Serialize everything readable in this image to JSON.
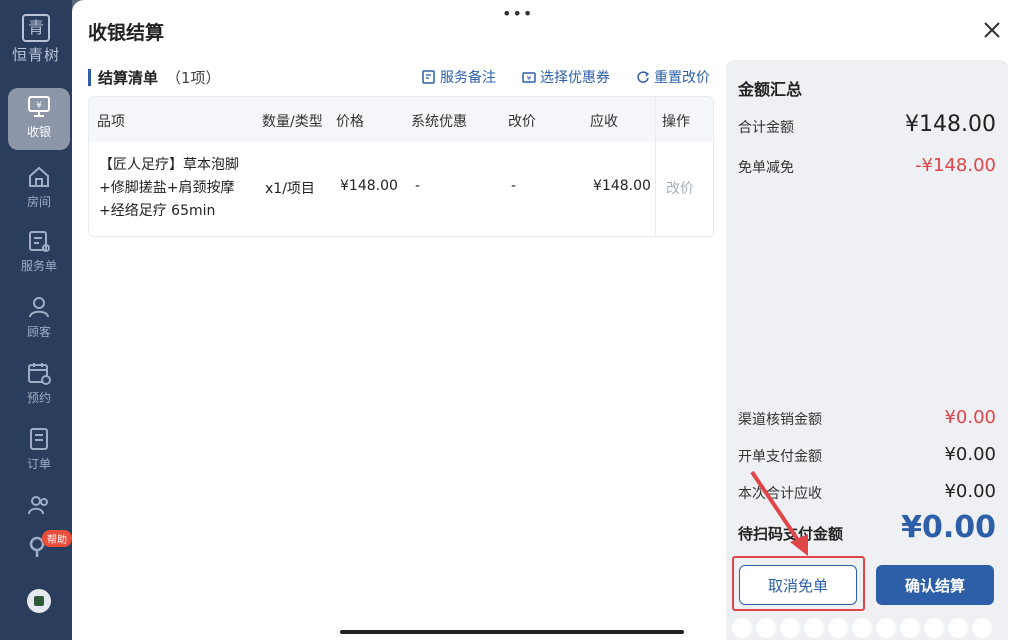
{
  "sidebar": {
    "logo_glyph": "青",
    "logo_name": "恒青树",
    "items": [
      {
        "label": "收银",
        "icon": "cashier-icon",
        "active": true
      },
      {
        "label": "房间",
        "icon": "home-icon"
      },
      {
        "label": "服务单",
        "icon": "service-order-icon"
      },
      {
        "label": "顾客",
        "icon": "customer-icon"
      },
      {
        "label": "预约",
        "icon": "calendar-icon"
      },
      {
        "label": "订单",
        "icon": "order-icon"
      }
    ],
    "badge": "帮助"
  },
  "dialog": {
    "title": "收银结算",
    "list_title": "结算清单",
    "list_count": "（1项）",
    "actions": [
      "服务备注",
      "选择优惠券",
      "重置改价"
    ]
  },
  "table": {
    "headers": [
      "品项",
      "数量/类型",
      "价格",
      "系统优惠",
      "改价",
      "应收",
      "操作"
    ],
    "rows": [
      {
        "name_lines": [
          "【匠人足疗】草本泡脚",
          "+修脚搓盐+肩颈按摩",
          "+经络足疗 65min"
        ],
        "qty": "x1/项目",
        "price": "¥148.00",
        "discount": "-",
        "modified": "-",
        "receivable": "¥148.00",
        "op": "改价"
      }
    ]
  },
  "summary": {
    "title": "金额汇总",
    "total_label": "合计金额",
    "total_value": "¥148.00",
    "waive_label": "免单减免",
    "waive_value": "-¥148.00",
    "channel_label": "渠道核销金额",
    "channel_value": "¥0.00",
    "open_label": "开单支付金额",
    "open_value": "¥0.00",
    "current_label": "本次合计应收",
    "current_value": "¥0.00",
    "scan_label": "待扫码支付金额",
    "scan_value": "¥0.00"
  },
  "buttons": {
    "cancel": "取消免单",
    "confirm": "确认结算"
  },
  "colors": {
    "accent": "#2d5fa8",
    "danger": "#e0454a",
    "sidebar": "#2b3d5c"
  }
}
